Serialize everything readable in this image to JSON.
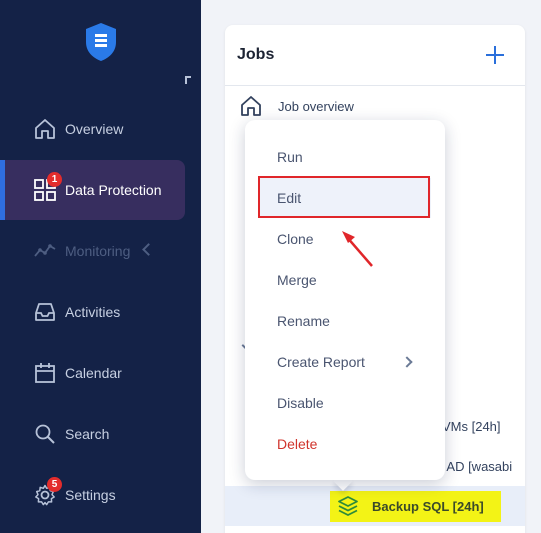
{
  "sidebar": {
    "items": [
      {
        "label": "Overview",
        "icon": "home-icon"
      },
      {
        "label": "Data Protection",
        "icon": "grid-icon",
        "badge": "1",
        "active": true
      },
      {
        "label": "Monitoring",
        "icon": "monitoring-icon",
        "disabled": true
      },
      {
        "label": "Activities",
        "icon": "inbox-icon"
      },
      {
        "label": "Calendar",
        "icon": "calendar-icon"
      },
      {
        "label": "Search",
        "icon": "search-icon"
      },
      {
        "label": "Settings",
        "icon": "gear-icon",
        "badge": "5"
      }
    ]
  },
  "jobs": {
    "title": "Jobs",
    "overview_label": "Job overview",
    "partial_job_1": "VMs [24h]",
    "partial_job_2": "y AD [wasabi",
    "selected_job": "Backup SQL [24h]"
  },
  "context_menu": {
    "items": [
      "Run",
      "Edit",
      "Clone",
      "Merge",
      "Rename",
      "Create Report",
      "Disable",
      "Delete"
    ]
  },
  "colors": {
    "sidebar_bg": "#142247",
    "active_bg": "#372e5f",
    "accent": "#2a6fdb",
    "danger": "#d0342c",
    "highlight": "#f3f316",
    "callout": "#e0262a"
  }
}
